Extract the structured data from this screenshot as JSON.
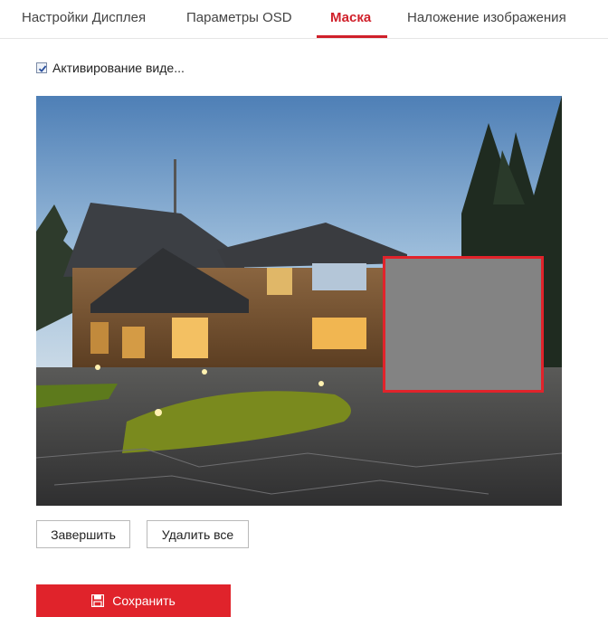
{
  "tabs": [
    {
      "label": "Настройки Дисплея"
    },
    {
      "label": "Параметры OSD"
    },
    {
      "label": "Маска",
      "active": true
    },
    {
      "label": "Наложение изображения"
    }
  ],
  "mask_enable": {
    "label": "Активирование виде...",
    "checked": true
  },
  "buttons": {
    "finish": "Завершить",
    "delete_all": "Удалить все",
    "save": "Сохранить"
  },
  "colors": {
    "accent": "#e0232b",
    "mask_fill": "#838383",
    "mask_border": "#e1232b"
  },
  "icons": {
    "save": "floppy-disk-icon",
    "checkbox": "checkmark-icon"
  }
}
